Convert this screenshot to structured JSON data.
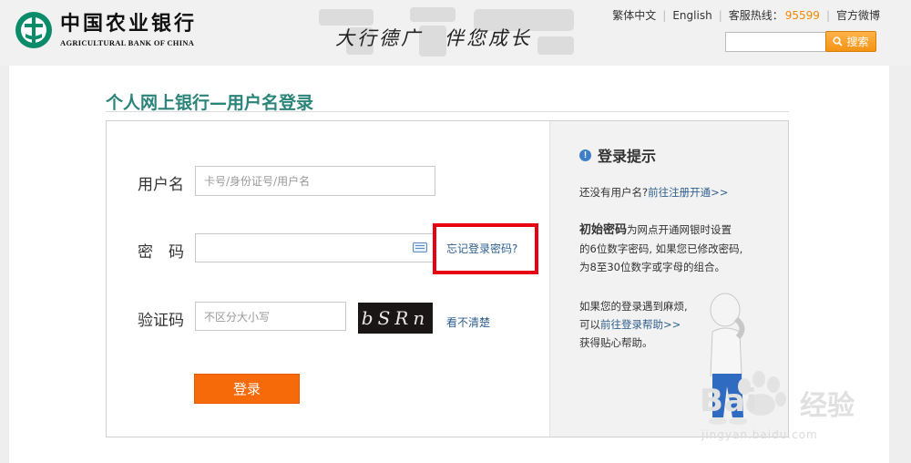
{
  "header": {
    "logo_cn": "中国农业银行",
    "logo_en": "AGRICULTURAL BANK OF CHINA",
    "slogan": "大行德广　伴您成长",
    "links": {
      "traditional": "繁体中文",
      "english": "English",
      "hotline_label": "客服热线：",
      "hotline_number": "95599",
      "weibo": "官方微博"
    },
    "search": {
      "value": "",
      "button_label": "搜索"
    }
  },
  "login": {
    "title": "个人网上银行—用户名登录",
    "username_label": "用户名",
    "username_placeholder": "卡号/身份证号/用户名",
    "password_label": "密　码",
    "password_value": "",
    "forgot_link": "忘记登录密码?",
    "captcha_label": "验证码",
    "captcha_placeholder": "不区分大小写",
    "captcha_text": "bSRn",
    "refresh_link": "看不清楚",
    "submit_label": "登录"
  },
  "tips": {
    "heading": "登录提示",
    "no_username": "还没有用户名?",
    "register_link": "前往注册开通>>",
    "initial_pw_bold": "初始密码",
    "initial_pw_line1": "为网点开通网银时设置",
    "initial_pw_line2": "的6位数字密码, 如果您已修改密码,",
    "initial_pw_line3": "为8至30位数字或字母的组合。",
    "trouble_line1": "如果您的登录遇到麻烦,",
    "trouble_prefix": "可以",
    "help_link": "前往登录帮助>>",
    "trouble_line3": "获得贴心帮助。"
  },
  "watermark": {
    "text_latin": "Bai",
    "text_cn": "经验",
    "url": "jingyan.baidu.com"
  },
  "colors": {
    "brand_green": "#2a8479",
    "accent_orange": "#f76a0a",
    "highlight_red": "#e60012",
    "link_blue": "#2f5f8f"
  }
}
